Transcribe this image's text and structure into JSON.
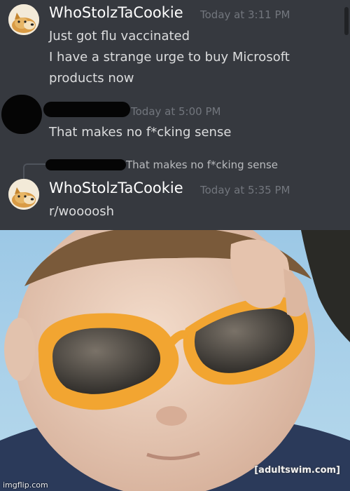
{
  "messages": [
    {
      "author": "WhoStolzTaCookie",
      "timestamp": "Today at 3:11 PM",
      "lines": [
        "Just got flu vaccinated",
        "I have a strange urge to buy Microsoft",
        "products now"
      ]
    },
    {
      "author": "",
      "timestamp": "Today at 5:00 PM",
      "lines": [
        "That makes no f*cking sense"
      ]
    },
    {
      "reply_to": "That makes no f*cking sense",
      "author": "WhoStolzTaCookie",
      "timestamp": "Today at 5:35 PM",
      "lines": [
        "r/woooosh"
      ]
    }
  ],
  "photo": {
    "caption": "[adultswim.com]",
    "watermark": "imgflip.com",
    "icon": "sunglasses-kid-photo"
  },
  "colors": {
    "background": "#36393f",
    "author": "#ffffff",
    "timestamp": "#72767d",
    "message": "#dcddde",
    "sunglasses": "#f2a531"
  }
}
